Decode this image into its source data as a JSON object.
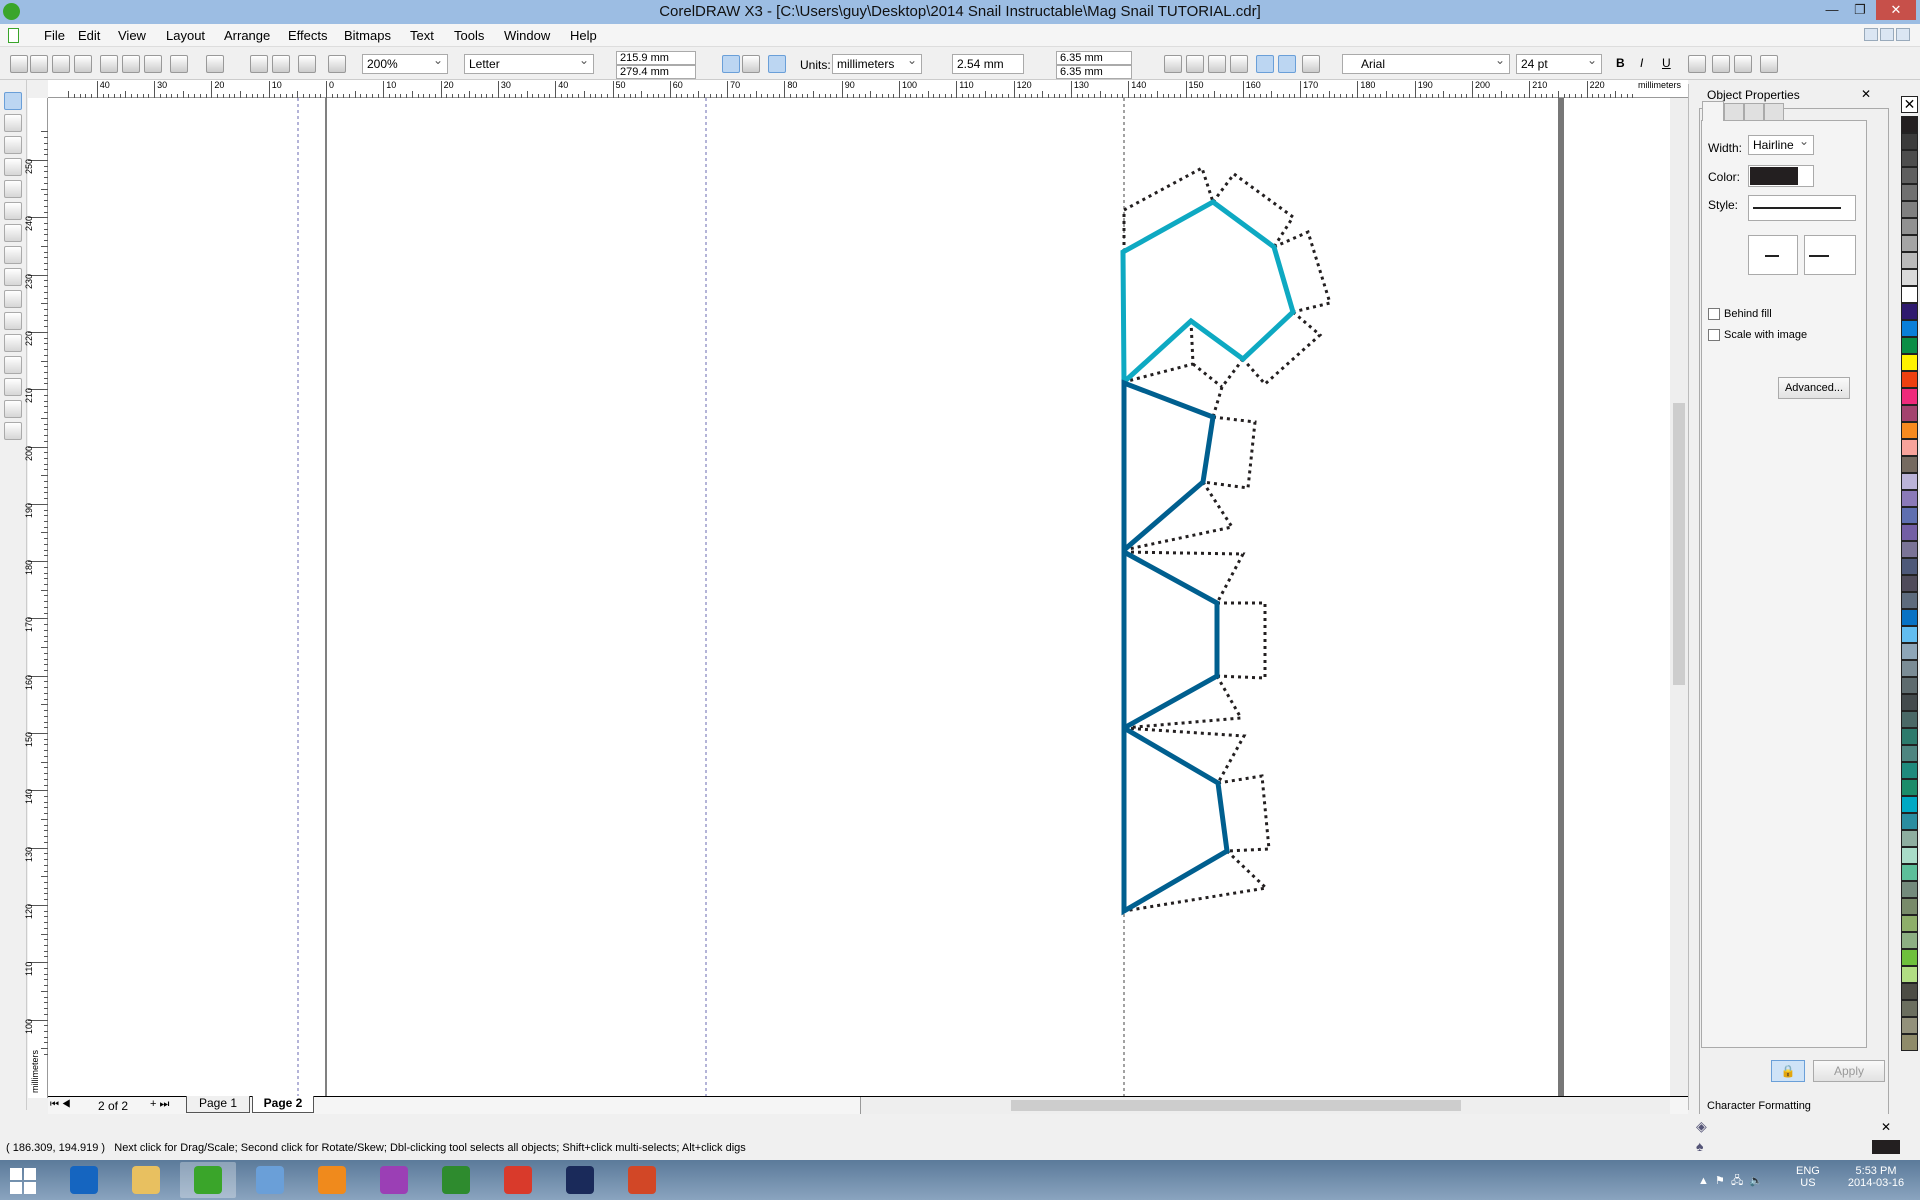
{
  "window": {
    "title": "CorelDRAW X3 - [C:\\Users\\guy\\Desktop\\2014 Snail Instructable\\Mag Snail TUTORIAL.cdr]",
    "minimize": "—",
    "restore": "❐",
    "close": "✕"
  },
  "menu": [
    "File",
    "Edit",
    "View",
    "Layout",
    "Arrange",
    "Effects",
    "Bitmaps",
    "Text",
    "Tools",
    "Window",
    "Help"
  ],
  "toolbar": {
    "zoom": "200%",
    "paper": "Letter",
    "width": "215.9 mm",
    "height": "279.4 mm",
    "units_label": "Units:",
    "units": "millimeters",
    "nudge": "2.54 mm",
    "dup_x": "6.35 mm",
    "dup_y": "6.35 mm",
    "font": "Arial",
    "font_size": "24 pt",
    "bold": "B",
    "italic": "I",
    "underline": "U"
  },
  "rulers": {
    "h_labels": [
      "40",
      "30",
      "20",
      "10",
      "0",
      "10",
      "20",
      "30",
      "40",
      "50",
      "60",
      "70",
      "80",
      "90",
      "100",
      "110",
      "120",
      "130",
      "140",
      "150",
      "160",
      "170",
      "180",
      "190",
      "200",
      "210",
      "220"
    ],
    "h_unit": "millimeters",
    "v_labels": [
      "250",
      "240",
      "230",
      "220",
      "210",
      "200",
      "190",
      "180",
      "170",
      "160",
      "150",
      "140",
      "130",
      "120",
      "110",
      "100"
    ],
    "v_unit": "millimeters"
  },
  "pages": {
    "counter": "2 of 2",
    "tabs": [
      "Page 1",
      "Page 2"
    ],
    "active": "Page 2"
  },
  "status": {
    "coords": "( 186.309, 194.919 )",
    "hint": "Next click for Drag/Scale; Second click for Rotate/Skew; Dbl-clicking tool selects all objects; Shift+click multi-selects; Alt+click digs"
  },
  "docker": {
    "title": "Object Properties",
    "width_label": "Width:",
    "width": "Hairline",
    "color_label": "Color:",
    "color": "#231f20",
    "style_label": "Style:",
    "behind_fill": "Behind fill",
    "scale_with_image": "Scale with image",
    "advanced": "Advanced...",
    "apply": "Apply",
    "char_formatting": "Character Formatting"
  },
  "drawing": {
    "cyan": "#0ea9c2",
    "blue": "#005f8f",
    "dotted": "#231f20"
  },
  "palette": [
    "#231f20",
    "#3a3a3a",
    "#4d4d4d",
    "#5f5f5f",
    "#707070",
    "#808080",
    "#919191",
    "#a5a5a5",
    "#bababa",
    "#d9d9d9",
    "#ffffff",
    "#2e1a6e",
    "#0a7fd8",
    "#0a8e45",
    "#fff200",
    "#ee4010",
    "#ee2a7b",
    "#a3426e",
    "#f68a1f",
    "#f7a39b",
    "#756a60",
    "#bbb3d8",
    "#8b7ab8",
    "#5f6fb0",
    "#735fa5",
    "#7a7396",
    "#4d5878",
    "#4f4b5a",
    "#5d6b7d",
    "#0872c4",
    "#62bdf0",
    "#8ea6b8",
    "#7b8c95",
    "#5e6b6e",
    "#434a4c",
    "#4a6866",
    "#2d7a6c",
    "#4e8580",
    "#1f8a7d",
    "#1c8c6a",
    "#00a9c4",
    "#2a8da0",
    "#8eaea0",
    "#a9dcc8",
    "#5cbf9a",
    "#738a7c",
    "#788a6a",
    "#8eae6a",
    "#8daf83",
    "#6ec03c",
    "#b1dd83",
    "#4d4d45",
    "#6b6e5f",
    "#93917b",
    "#8f8b6a"
  ],
  "tray": {
    "lang1": "ENG",
    "lang2": "US",
    "time": "5:53 PM",
    "date": "2014-03-16"
  },
  "taskbar_apps": [
    {
      "name": "start-screen",
      "color": "#1565c0"
    },
    {
      "name": "file-explorer",
      "color": "#e8c060"
    },
    {
      "name": "coreldraw",
      "color": "#3aa52a"
    },
    {
      "name": "calculator",
      "color": "#6a9fd8"
    },
    {
      "name": "media-player",
      "color": "#f08a1c"
    },
    {
      "name": "picasa",
      "color": "#9b3fb5"
    },
    {
      "name": "media-center",
      "color": "#2e8b2e"
    },
    {
      "name": "chrome",
      "color": "#d93a2b"
    },
    {
      "name": "app-swirl",
      "color": "#1a2a5a"
    },
    {
      "name": "powerpoint",
      "color": "#d24726"
    }
  ]
}
